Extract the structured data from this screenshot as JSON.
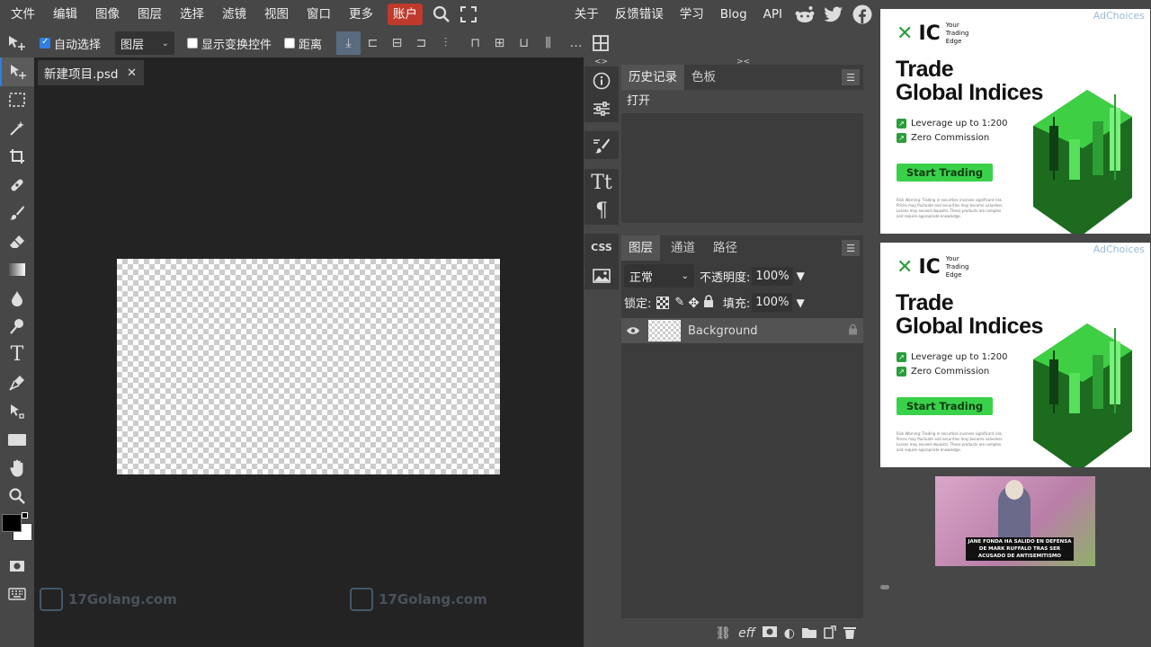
{
  "menubar": {
    "items": [
      "文件",
      "编辑",
      "图像",
      "图层",
      "选择",
      "滤镜",
      "视图",
      "窗口",
      "更多"
    ],
    "account": "账户",
    "right_items": [
      "关于",
      "反馈错误",
      "学习",
      "Blog",
      "API"
    ],
    "account_color": "#c0392b"
  },
  "options": {
    "auto_select": "自动选择",
    "auto_select_checked": true,
    "target_select": "图层",
    "show_transform": "显示变换控件",
    "show_transform_checked": false,
    "distance": "距离",
    "distance_checked": false
  },
  "document": {
    "tab_title": "新建项目.psd",
    "close": "✕"
  },
  "watermark": {
    "text": "17Golang.com"
  },
  "history": {
    "tabs": [
      "历史记录",
      "色板"
    ],
    "entries": [
      "打开"
    ]
  },
  "layers": {
    "tabs": [
      "图层",
      "通道",
      "路径"
    ],
    "blend_mode": "正常",
    "opacity_label": "不透明度:",
    "opacity_value": "100%",
    "lock_label": "锁定:",
    "fill_label": "填充:",
    "fill_value": "100%",
    "items": [
      {
        "name": "Background",
        "visible": true,
        "locked": true
      }
    ]
  },
  "iconcol": {
    "css_label": "CSS"
  },
  "ads": {
    "adchoices": "AdChoices",
    "logo_letters": "IC",
    "logo_tagline": "Your Trading Edge",
    "title_line1": "Trade",
    "title_line2": "Global Indices",
    "bullet1": "Leverage up to 1:200",
    "bullet2": "Zero Commission",
    "cta": "Start Trading",
    "warning": "Risk Warning: Trading in securities involves significant risk. Prices may fluctuate and securities may become valueless. Losses may exceed deposits. These products are complex and require appropriate knowledge.",
    "brand_color": "#3ad14a",
    "news_caption": "JANE FONDA HA SALIDO EN DEFENSA DE MARK RUFFALO TRAS SER ACUSADO DE ANTISEMITISMO"
  },
  "colors": {
    "accent": "#2f7fe0",
    "panel_bg": "#474747",
    "workspace_bg": "#232323"
  }
}
